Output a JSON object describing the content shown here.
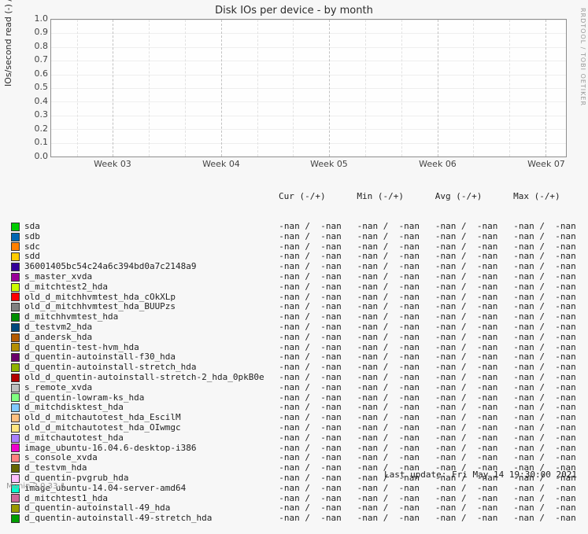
{
  "title": "Disk IOs per device - by month",
  "ylabel": "IOs/second read (-) / write (+)",
  "rrdtool_credit": "RRDTOOL / TOBI OETIKER",
  "chart_data": {
    "type": "line",
    "x_categories": [
      "Week 03",
      "Week 04",
      "Week 05",
      "Week 06",
      "Week 07"
    ],
    "ylim": [
      0.0,
      1.0
    ],
    "yticks": [
      0.0,
      0.1,
      0.2,
      0.3,
      0.4,
      0.5,
      0.6,
      0.7,
      0.8,
      0.9,
      1.0
    ],
    "series": [],
    "note": "Plot area is empty; all series have no numeric data (NaN)."
  },
  "legend_header": {
    "cur": "Cur (-/+)",
    "min": "Min (-/+)",
    "avg": "Avg (-/+)",
    "max": "Max (-/+)"
  },
  "nan_pair": "-nan /  -nan",
  "devices": [
    {
      "name": "sda",
      "color": "#00cc00"
    },
    {
      "name": "sdb",
      "color": "#0066b3"
    },
    {
      "name": "sdc",
      "color": "#ff8000"
    },
    {
      "name": "sdd",
      "color": "#ffcc00"
    },
    {
      "name": "36001405bc54c24a6c394bd0a7c2148a9",
      "color": "#330099"
    },
    {
      "name": "s_master_xvda",
      "color": "#990099"
    },
    {
      "name": "d_mitchtest2_hda",
      "color": "#ccff00"
    },
    {
      "name": "old_d_mitchhvmtest_hda_cOkXLp",
      "color": "#ff0000"
    },
    {
      "name": "old_d_mitchhvmtest_hda_BUUPzs",
      "color": "#808080"
    },
    {
      "name": "d_mitchhvmtest_hda",
      "color": "#008f00"
    },
    {
      "name": "d_testvm2_hda",
      "color": "#00487d"
    },
    {
      "name": "d_andersk_hda",
      "color": "#b35a00"
    },
    {
      "name": "d_quentin-test-hvm_hda",
      "color": "#b38f00"
    },
    {
      "name": "d_quentin-autoinstall-f30_hda",
      "color": "#6b006b"
    },
    {
      "name": "d_quentin-autoinstall-stretch_hda",
      "color": "#8fb300"
    },
    {
      "name": "old_d_quentin-autoinstall-stretch-2_hda_0pkB0e",
      "color": "#b30000"
    },
    {
      "name": "s_remote_xvda",
      "color": "#bebebe"
    },
    {
      "name": "d_quentin-lowram-ks_hda",
      "color": "#80ff80"
    },
    {
      "name": "d_mitchdisktest_hda",
      "color": "#80c9ff"
    },
    {
      "name": "old_d_mitchautotest_hda_EscilM",
      "color": "#ffc080"
    },
    {
      "name": "old_d_mitchautotest_hda_OIwmgc",
      "color": "#ffe680"
    },
    {
      "name": "d_mitchautotest_hda",
      "color": "#aa80ff"
    },
    {
      "name": "image_ubuntu-16.04.6-desktop-i386",
      "color": "#ee00cc"
    },
    {
      "name": "s_console_xvda",
      "color": "#ff8080"
    },
    {
      "name": "d_testvm_hda",
      "color": "#666600"
    },
    {
      "name": "d_quentin-pvgrub_hda",
      "color": "#ffbfff"
    },
    {
      "name": "image_ubuntu-14.04-server-amd64",
      "color": "#00ffcc"
    },
    {
      "name": "d_mitchtest1_hda",
      "color": "#cc6699"
    },
    {
      "name": "d_quentin-autoinstall-49_hda",
      "color": "#999900"
    },
    {
      "name": "d_quentin-autoinstall-49-stretch_hda",
      "color": "#009e00"
    }
  ],
  "footer_left": "Munin 2.0.33-1",
  "footer_right": "Last update: Fri May 14 19:30:00 2021"
}
